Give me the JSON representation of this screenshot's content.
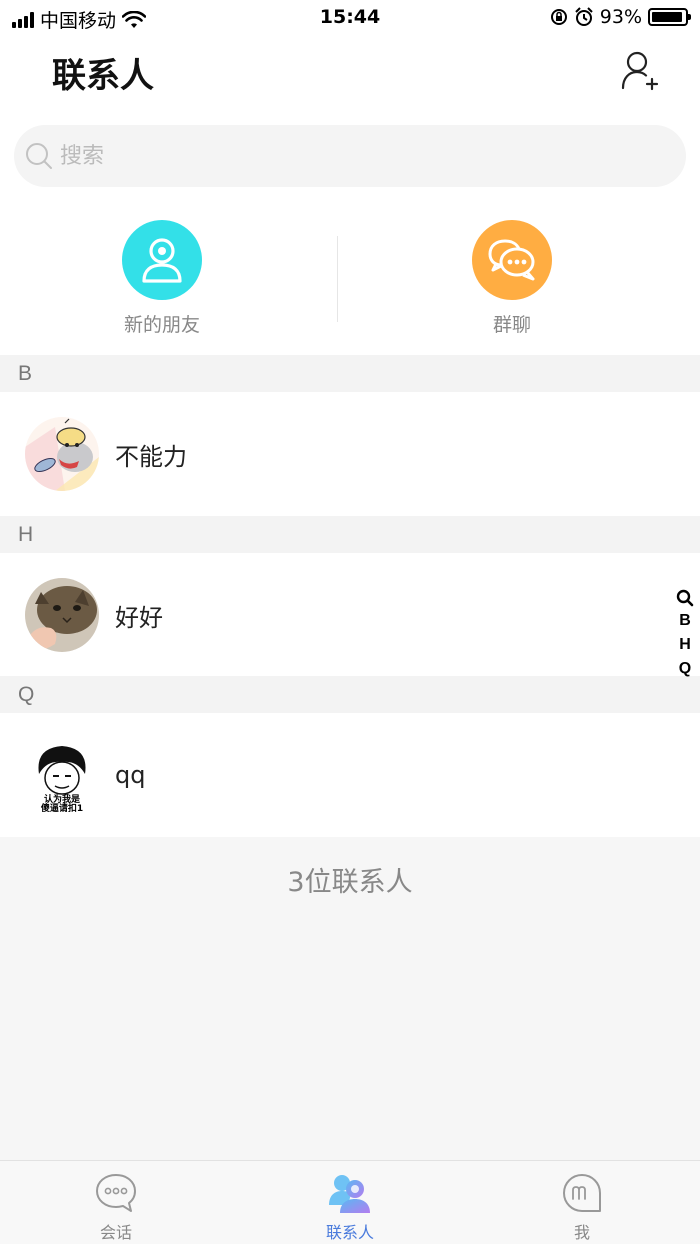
{
  "status_bar": {
    "carrier": "中国移动",
    "time": "15:44",
    "battery_percent": "93%",
    "battery_level": 0.93
  },
  "header": {
    "title": "联系人",
    "add_contact_icon": "add-user-icon"
  },
  "search": {
    "placeholder": "搜索"
  },
  "quick_actions": [
    {
      "label": "新的朋友",
      "icon": "person-icon",
      "color": "#33e0e8"
    },
    {
      "label": "群聊",
      "icon": "chat-bubbles-icon",
      "color": "#ffad42"
    }
  ],
  "sections": [
    {
      "letter": "B",
      "contacts": [
        {
          "name": "不能力"
        }
      ]
    },
    {
      "letter": "H",
      "contacts": [
        {
          "name": "好好"
        }
      ]
    },
    {
      "letter": "Q",
      "contacts": [
        {
          "name": "qq",
          "avatar_caption_1": "认为我是",
          "avatar_caption_2": "傻逼请扣1"
        }
      ]
    }
  ],
  "index_bar": [
    "B",
    "H",
    "Q"
  ],
  "contact_count": "3位联系人",
  "tabs": [
    {
      "label": "会话",
      "icon": "chat-bubble-icon",
      "active": false
    },
    {
      "label": "联系人",
      "icon": "contacts-icon",
      "active": true
    },
    {
      "label": "我",
      "icon": "me-icon",
      "active": false
    }
  ],
  "colors": {
    "accent": "#4a7bdc",
    "new_friend": "#33e0e8",
    "group_chat": "#ffad42"
  }
}
